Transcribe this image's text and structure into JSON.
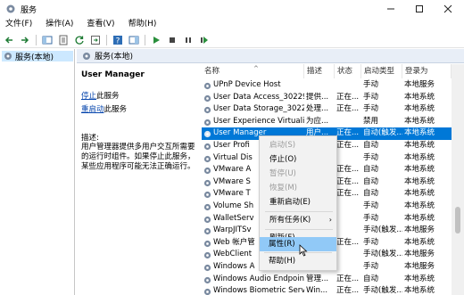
{
  "window": {
    "title": "服务"
  },
  "menu": [
    "文件(F)",
    "操作(A)",
    "查看(V)",
    "帮助(H)"
  ],
  "tree": {
    "selected": "服务(本地)"
  },
  "pane_header": "服务(本地)",
  "desc": {
    "title": "User Manager",
    "stop_link": "停止",
    "stop_suffix": "此服务",
    "restart_link": "重启动",
    "restart_suffix": "此服务",
    "label": "描述:",
    "text": "用户管理器提供多用户交互所需要的运行时组件。如果停止此服务，某些应用程序可能无法正确运行。"
  },
  "columns": {
    "name": "名称",
    "desc": "描述",
    "status": "状态",
    "start": "启动类型",
    "logon": "登录为"
  },
  "rows": [
    {
      "name": "UPnP Device Host",
      "desc": "",
      "status": "",
      "start": "手动",
      "logon": "本地服务"
    },
    {
      "name": "User Data Access_30229",
      "desc": "提供...",
      "status": "正在...",
      "start": "手动",
      "logon": "本地系统"
    },
    {
      "name": "User Data Storage_30229",
      "desc": "处理...",
      "status": "正在...",
      "start": "手动",
      "logon": "本地系统"
    },
    {
      "name": "User Experience Virtualiz...",
      "desc": "为应...",
      "status": "",
      "start": "禁用",
      "logon": "本地系统"
    },
    {
      "name": "User Manager",
      "desc": "用户...",
      "status": "正在...",
      "start": "自动(触发...",
      "logon": "本地系统"
    },
    {
      "name": "User Profi",
      "desc": "",
      "status": "正在...",
      "start": "自动",
      "logon": "本地系统"
    },
    {
      "name": "Virtual Dis",
      "desc": "",
      "status": "",
      "start": "手动",
      "logon": "本地系统"
    },
    {
      "name": "VMware A",
      "desc": "",
      "status": "正在...",
      "start": "自动",
      "logon": "本地系统"
    },
    {
      "name": "VMware S",
      "desc": "",
      "status": "正在...",
      "start": "自动",
      "logon": "本地系统"
    },
    {
      "name": "VMware T",
      "desc": "",
      "status": "正在...",
      "start": "自动",
      "logon": "本地系统"
    },
    {
      "name": "Volume Sh",
      "desc": "",
      "status": "",
      "start": "手动",
      "logon": "本地系统"
    },
    {
      "name": "WalletServ",
      "desc": "",
      "status": "",
      "start": "手动",
      "logon": "本地系统"
    },
    {
      "name": "WarpJITSv",
      "desc": "",
      "status": "",
      "start": "手动(触发...",
      "logon": "本地服务"
    },
    {
      "name": "Web 帐户管",
      "desc": "",
      "status": "正在...",
      "start": "手动",
      "logon": "本地系统"
    },
    {
      "name": "WebClient",
      "desc": "",
      "status": "",
      "start": "手动(触发...",
      "logon": "本地服务"
    },
    {
      "name": "Windows A",
      "desc": "",
      "status": "",
      "start": "手动",
      "logon": "本地服务"
    },
    {
      "name": "Windows Audio Endpoint B...",
      "desc": "管理...",
      "status": "正在...",
      "start": "自动",
      "logon": "本地系统"
    },
    {
      "name": "Windows Biometric Servi...",
      "desc": "Win...",
      "status": "正在...",
      "start": "手动(触发...",
      "logon": "本地系统"
    }
  ],
  "selected_row": 4,
  "context_menu": {
    "start": "启动(S)",
    "stop": "停止(O)",
    "pause": "暂停(U)",
    "resume": "恢复(M)",
    "restart": "重新启动(E)",
    "all_tasks": "所有任务(K)",
    "refresh": "刷新(F)",
    "properties": "属性(R)",
    "help": "帮助(H)"
  },
  "colors": {
    "selection": "#0078d7",
    "menu_highlight": "#91c9f7",
    "pane_header": "#e8eef7",
    "link": "#0645ad"
  }
}
